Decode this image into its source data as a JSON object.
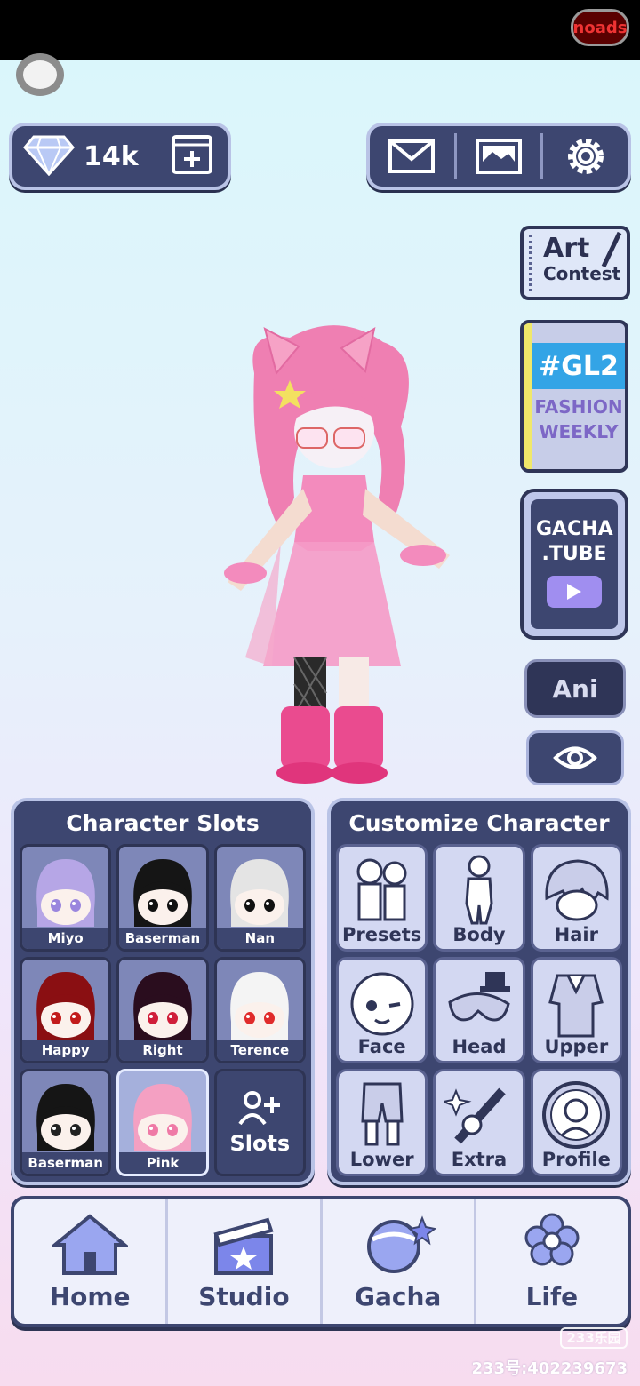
{
  "top": {
    "noads_label": "noads"
  },
  "currency": {
    "gems": "14k",
    "icons": [
      "diamond-icon",
      "add-video-icon"
    ]
  },
  "top_buttons": [
    "mail-icon",
    "gallery-icon",
    "settings-gear-icon"
  ],
  "side": {
    "art_contest": {
      "line1": "Art",
      "line2": "Contest"
    },
    "gl2": {
      "tag": "#GL2",
      "line1": "FASHION",
      "line2": "WEEKLY"
    },
    "gacha_tube": {
      "line1": "GACHA",
      "line2": ".TUBE"
    },
    "ani_label": "Ani",
    "eye_icon": "eye-icon"
  },
  "slots": {
    "title": "Character Slots",
    "items": [
      {
        "name": "Miyo",
        "hair": "#b6a6e6",
        "eyes": "#9a86de"
      },
      {
        "name": "Baserman",
        "hair": "#151515",
        "eyes": "#111111"
      },
      {
        "name": "Nan",
        "hair": "#e4e4e4",
        "eyes": "#111111"
      },
      {
        "name": "Happy",
        "hair": "#8a0f12",
        "eyes": "#c21b1b"
      },
      {
        "name": "Right",
        "hair": "#2a0d1e",
        "eyes": "#d01e3a"
      },
      {
        "name": "Terence",
        "hair": "#f4f4f4",
        "eyes": "#e02b2b"
      },
      {
        "name": "Baserman",
        "hair": "#151515",
        "eyes": "#222222"
      },
      {
        "name": "Pink",
        "hair": "#f4a0c2",
        "eyes": "#ef79a6"
      }
    ],
    "add_label": "Slots"
  },
  "customize": {
    "title": "Customize Character",
    "buttons": [
      {
        "label": "Presets",
        "icon": "presets-icon"
      },
      {
        "label": "Body",
        "icon": "body-icon"
      },
      {
        "label": "Hair",
        "icon": "hair-icon"
      },
      {
        "label": "Face",
        "icon": "face-icon"
      },
      {
        "label": "Head",
        "icon": "head-accessory-icon"
      },
      {
        "label": "Upper",
        "icon": "upper-clothing-icon"
      },
      {
        "label": "Lower",
        "icon": "lower-clothing-icon"
      },
      {
        "label": "Extra",
        "icon": "extra-weapon-icon"
      },
      {
        "label": "Profile",
        "icon": "profile-icon"
      }
    ]
  },
  "nav": [
    {
      "label": "Home",
      "icon": "home-icon"
    },
    {
      "label": "Studio",
      "icon": "studio-clapper-icon"
    },
    {
      "label": "Gacha",
      "icon": "gacha-orb-icon"
    },
    {
      "label": "Life",
      "icon": "life-flower-icon"
    }
  ],
  "watermark": {
    "badge": "233乐园",
    "id": "233号:402239673"
  }
}
